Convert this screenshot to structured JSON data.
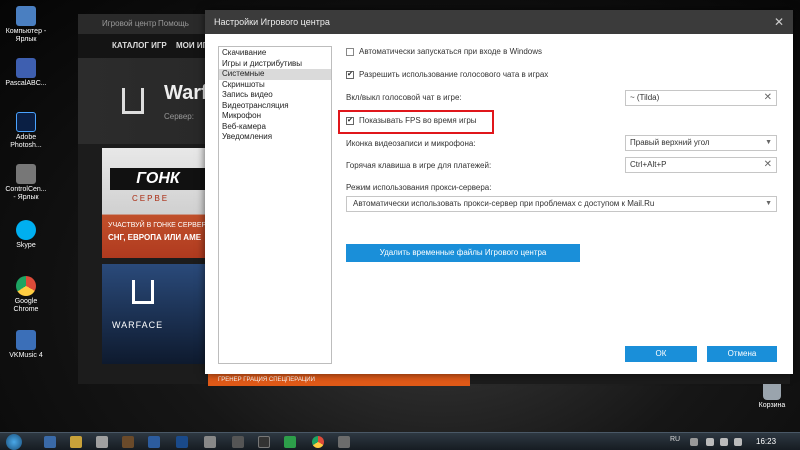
{
  "desktop": {
    "icons": [
      {
        "label": "Компьютер - Ярлык",
        "color": "#4a7fc1"
      },
      {
        "label": "PascalABC...",
        "color": "#3e5fb0"
      },
      {
        "label": "Adobe Photosh...",
        "color": "#0a1f44"
      },
      {
        "label": "ControlCen... - Ярлык",
        "color": "#777777"
      },
      {
        "label": "Skype",
        "color": "#00aff0"
      },
      {
        "label": "Google Chrome",
        "color": "#dd4b39"
      },
      {
        "label": "VKMusic 4",
        "color": "#3b6fb8"
      }
    ],
    "recycle_bin": "Корзина"
  },
  "game_center": {
    "title_app": "Игровой центр",
    "title_help": "Помощь",
    "nav_catalog": "КАТАЛОГ ИГР",
    "nav_mygames": "МОИ ИГ",
    "hero_title": "Warf",
    "hero_server": "Сервер:",
    "banner_top_title": "ГОНК",
    "banner_top_sub": "СЕРВЕ",
    "banner_top_line1": "УЧАСТВУЙ В ГОНКЕ СЕРВЕР",
    "banner_top_line2": "СНГ, ЕВРОПА ИЛИ АМЕ",
    "banner_bottom_title": "WARFACE",
    "footer_strip": "ГРЕНЕР ГРАЦИЯ СПЕЦПЕРАЦИИ"
  },
  "dialog": {
    "title": "Настройки Игрового центра",
    "close": "✕",
    "sidebar": {
      "items": [
        {
          "label": "Скачивание"
        },
        {
          "label": "Игры и дистрибутивы"
        },
        {
          "label": "Системные"
        },
        {
          "label": "Скриншоты"
        },
        {
          "label": "Запись видео"
        },
        {
          "label": "Видеотрансляция"
        },
        {
          "label": "Микрофон"
        },
        {
          "label": "Веб-камера"
        },
        {
          "label": "Уведомления"
        }
      ],
      "selected_index": 2
    },
    "autostart_label": "Автоматически запускаться при входе в Windows",
    "autostart_checked": false,
    "voice_chat_label": "Разрешить использование голосового чата в играх",
    "voice_chat_checked": true,
    "voice_hotkey_label": "Вкл/выкл голосовой чат в игре:",
    "voice_hotkey_value": "~ (Tilda)",
    "show_fps_label": "Показывать FPS во время игры",
    "show_fps_checked": true,
    "record_icon_label": "Иконка видеозаписи и микрофона:",
    "record_icon_value": "Правый верхний угол",
    "payment_hotkey_label": "Горячая клавиша в игре для платежей:",
    "payment_hotkey_value": "Ctrl+Alt+P",
    "proxy_label": "Режим использования прокси-сервера:",
    "proxy_value": "Автоматически использовать прокси-сервер при проблемах с доступом к Mail.Ru",
    "delete_temp_button": "Удалить временные файлы Игрового центра",
    "ok_button": "ОК",
    "cancel_button": "Отмена",
    "clear_symbol": "✕",
    "dropdown_symbol": "▼",
    "check_symbol": "✔"
  },
  "taskbar": {
    "language": "RU",
    "time": "16:23"
  },
  "colors": {
    "accent_blue": "#1a8fd9",
    "highlight_red": "#e0161b",
    "dialog_title_bg": "#3b3b3b"
  }
}
